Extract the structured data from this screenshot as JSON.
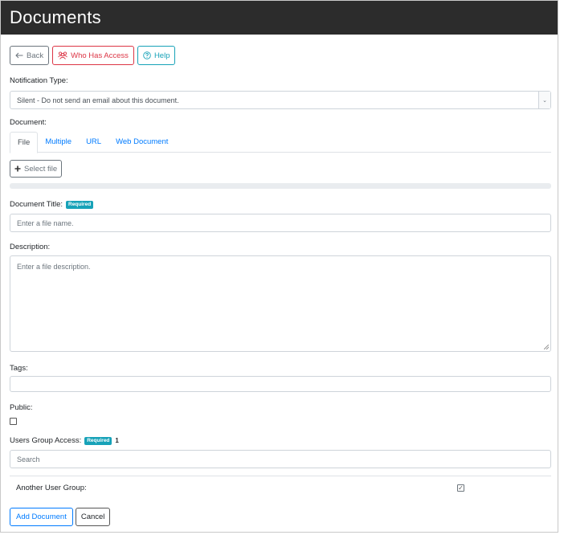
{
  "window": {
    "title": "Documents"
  },
  "toolbar": {
    "back_label": "Back",
    "who_label": "Who Has Access",
    "help_label": "Help"
  },
  "notification": {
    "label": "Notification Type:",
    "selected": "Silent - Do not send an email about this document."
  },
  "document": {
    "label": "Document:",
    "tabs": [
      {
        "label": "File",
        "active": true
      },
      {
        "label": "Multiple",
        "active": false
      },
      {
        "label": "URL",
        "active": false
      },
      {
        "label": "Web Document",
        "active": false
      }
    ],
    "select_file_label": "Select file",
    "upload_progress": 0
  },
  "title_field": {
    "label": "Document Title:",
    "badge": "Required",
    "placeholder": "Enter a file name."
  },
  "description_field": {
    "label": "Description:",
    "placeholder": "Enter a file description."
  },
  "tags_field": {
    "label": "Tags:",
    "value": ""
  },
  "public_field": {
    "label": "Public:",
    "checked": false
  },
  "users_group": {
    "label": "Users Group Access:",
    "badge": "Required",
    "count": "1",
    "search_placeholder": "Search",
    "groups": [
      {
        "name": "Another User Group:",
        "checked": true
      }
    ]
  },
  "actions": {
    "add_label": "Add Document",
    "cancel_label": "Cancel"
  },
  "colors": {
    "titlebar_bg": "#2c2c2c",
    "primary": "#007bff",
    "danger": "#dc3545",
    "info": "#17a2b8",
    "secondary": "#6c757d"
  }
}
